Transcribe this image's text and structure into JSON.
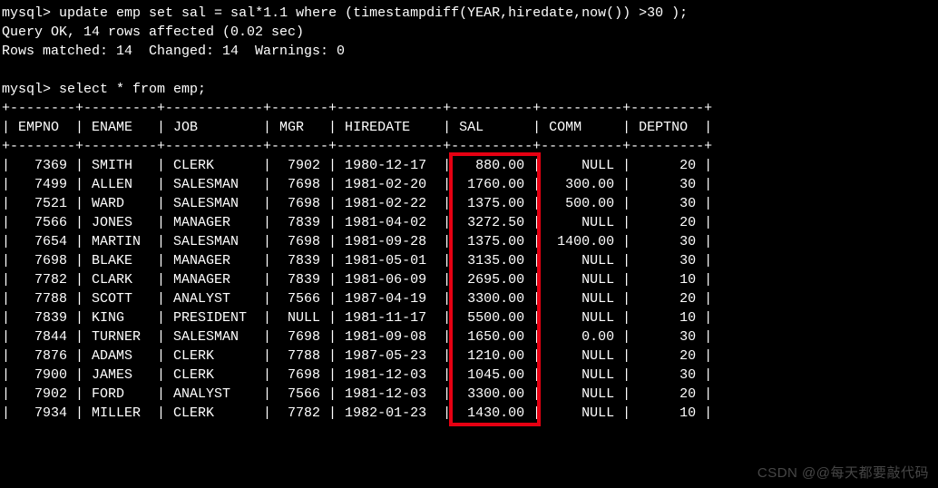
{
  "prompt": "mysql>",
  "commands": {
    "update": "update emp set sal = sal*1.1 where (timestampdiff(YEAR,hiredate,now()) >30 );",
    "update_result1": "Query OK, 14 rows affected (0.02 sec)",
    "update_result2": "Rows matched: 14  Changed: 14  Warnings: 0",
    "select": "select * from emp;"
  },
  "table": {
    "headers": [
      "EMPNO",
      "ENAME",
      "JOB",
      "MGR",
      "HIREDATE",
      "SAL",
      "COMM",
      "DEPTNO"
    ],
    "rows": [
      {
        "empno": "7369",
        "ename": "SMITH",
        "job": "CLERK",
        "mgr": "7902",
        "hiredate": "1980-12-17",
        "sal": "880.00",
        "comm": "NULL",
        "deptno": "20"
      },
      {
        "empno": "7499",
        "ename": "ALLEN",
        "job": "SALESMAN",
        "mgr": "7698",
        "hiredate": "1981-02-20",
        "sal": "1760.00",
        "comm": "300.00",
        "deptno": "30"
      },
      {
        "empno": "7521",
        "ename": "WARD",
        "job": "SALESMAN",
        "mgr": "7698",
        "hiredate": "1981-02-22",
        "sal": "1375.00",
        "comm": "500.00",
        "deptno": "30"
      },
      {
        "empno": "7566",
        "ename": "JONES",
        "job": "MANAGER",
        "mgr": "7839",
        "hiredate": "1981-04-02",
        "sal": "3272.50",
        "comm": "NULL",
        "deptno": "20"
      },
      {
        "empno": "7654",
        "ename": "MARTIN",
        "job": "SALESMAN",
        "mgr": "7698",
        "hiredate": "1981-09-28",
        "sal": "1375.00",
        "comm": "1400.00",
        "deptno": "30"
      },
      {
        "empno": "7698",
        "ename": "BLAKE",
        "job": "MANAGER",
        "mgr": "7839",
        "hiredate": "1981-05-01",
        "sal": "3135.00",
        "comm": "NULL",
        "deptno": "30"
      },
      {
        "empno": "7782",
        "ename": "CLARK",
        "job": "MANAGER",
        "mgr": "7839",
        "hiredate": "1981-06-09",
        "sal": "2695.00",
        "comm": "NULL",
        "deptno": "10"
      },
      {
        "empno": "7788",
        "ename": "SCOTT",
        "job": "ANALYST",
        "mgr": "7566",
        "hiredate": "1987-04-19",
        "sal": "3300.00",
        "comm": "NULL",
        "deptno": "20"
      },
      {
        "empno": "7839",
        "ename": "KING",
        "job": "PRESIDENT",
        "mgr": "NULL",
        "hiredate": "1981-11-17",
        "sal": "5500.00",
        "comm": "NULL",
        "deptno": "10"
      },
      {
        "empno": "7844",
        "ename": "TURNER",
        "job": "SALESMAN",
        "mgr": "7698",
        "hiredate": "1981-09-08",
        "sal": "1650.00",
        "comm": "0.00",
        "deptno": "30"
      },
      {
        "empno": "7876",
        "ename": "ADAMS",
        "job": "CLERK",
        "mgr": "7788",
        "hiredate": "1987-05-23",
        "sal": "1210.00",
        "comm": "NULL",
        "deptno": "20"
      },
      {
        "empno": "7900",
        "ename": "JAMES",
        "job": "CLERK",
        "mgr": "7698",
        "hiredate": "1981-12-03",
        "sal": "1045.00",
        "comm": "NULL",
        "deptno": "30"
      },
      {
        "empno": "7902",
        "ename": "FORD",
        "job": "ANALYST",
        "mgr": "7566",
        "hiredate": "1981-12-03",
        "sal": "3300.00",
        "comm": "NULL",
        "deptno": "20"
      },
      {
        "empno": "7934",
        "ename": "MILLER",
        "job": "CLERK",
        "mgr": "7782",
        "hiredate": "1982-01-23",
        "sal": "1430.00",
        "comm": "NULL",
        "deptno": "10"
      }
    ]
  },
  "watermark": "CSDN @@每天都要敲代码"
}
